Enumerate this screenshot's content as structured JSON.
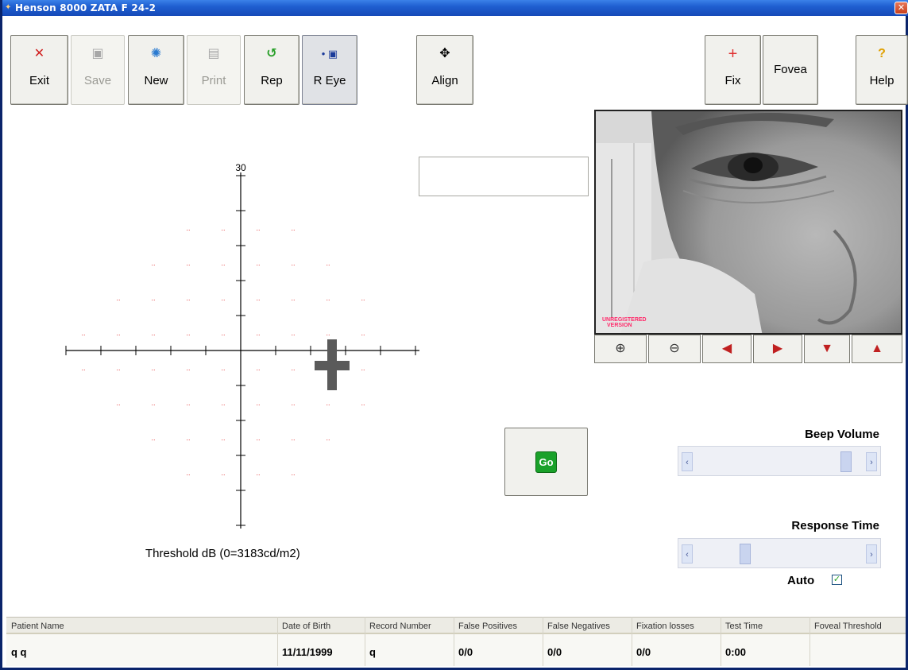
{
  "window": {
    "title": "Henson 8000 ZATA F 24-2",
    "close_glyph": "✕"
  },
  "toolbar": {
    "exit": "Exit",
    "save": "Save",
    "new": "New",
    "print": "Print",
    "rep": "Rep",
    "r_eye": "R Eye",
    "align": "Align",
    "fix": "Fix",
    "fovea": "Fovea",
    "help": "Help"
  },
  "plot": {
    "axis_top_label": "30",
    "point_marker": "..",
    "point_color": "#e03030",
    "caption": "Threshold dB (0=3183cd/m2)"
  },
  "camera": {
    "watermark_line1": "UNREGISTERED",
    "watermark_line2": "VERSION"
  },
  "camera_controls": [
    "zoom-in",
    "zoom-out",
    "pan-left",
    "pan-right",
    "pan-down",
    "pan-up"
  ],
  "go_label": "Go",
  "beep_volume": {
    "label": "Beep Volume",
    "level": 0.92
  },
  "response_time": {
    "label": "Response Time",
    "level": 0.28
  },
  "auto": {
    "label": "Auto",
    "checked": true
  },
  "table": {
    "headers": [
      "Patient Name",
      "Date of Birth",
      "Record Number",
      "False Positives",
      "False Negatives",
      "Fixation losses",
      "Test Time",
      "Foveal Threshold"
    ],
    "row": [
      "q q",
      "11/11/1999",
      "q",
      "0/0",
      "0/0",
      "0/0",
      "0:00",
      ""
    ]
  }
}
